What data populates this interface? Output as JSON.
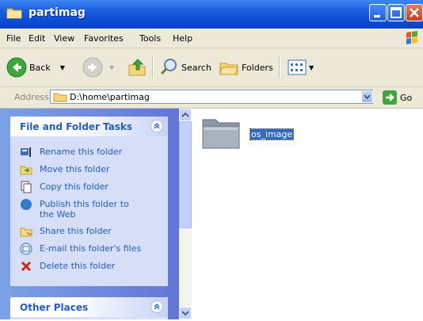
{
  "window": {
    "title": "partimag"
  },
  "menu": [
    "File",
    "Edit",
    "View",
    "Favorites",
    "Tools",
    "Help"
  ],
  "toolbar": {
    "back_label": "Back",
    "search_label": "Search",
    "folders_label": "Folders"
  },
  "address": {
    "label": "Address",
    "path": "D:\\home\\partimag",
    "go_label": "Go"
  },
  "tasks_panel": {
    "title": "File and Folder Tasks",
    "items": [
      {
        "label": "Rename this folder",
        "icon": "rename-icon"
      },
      {
        "label": "Move this folder",
        "icon": "move-icon"
      },
      {
        "label": "Copy this folder",
        "icon": "copy-icon"
      },
      {
        "label": "Publish this folder to the Web",
        "icon": "globe-icon"
      },
      {
        "label": "Share this folder",
        "icon": "share-icon"
      },
      {
        "label": "E-mail this folder's files",
        "icon": "email-icon"
      },
      {
        "label": "Delete this folder",
        "icon": "delete-icon"
      }
    ]
  },
  "other_places": {
    "title": "Other Places"
  },
  "content": {
    "folders": [
      {
        "name": "os_image",
        "selected": true
      }
    ]
  },
  "colors": {
    "titlebar": "#0a4ed6",
    "pane_blue": "#6375d6",
    "link": "#215dc6",
    "selection": "#316ac5"
  }
}
